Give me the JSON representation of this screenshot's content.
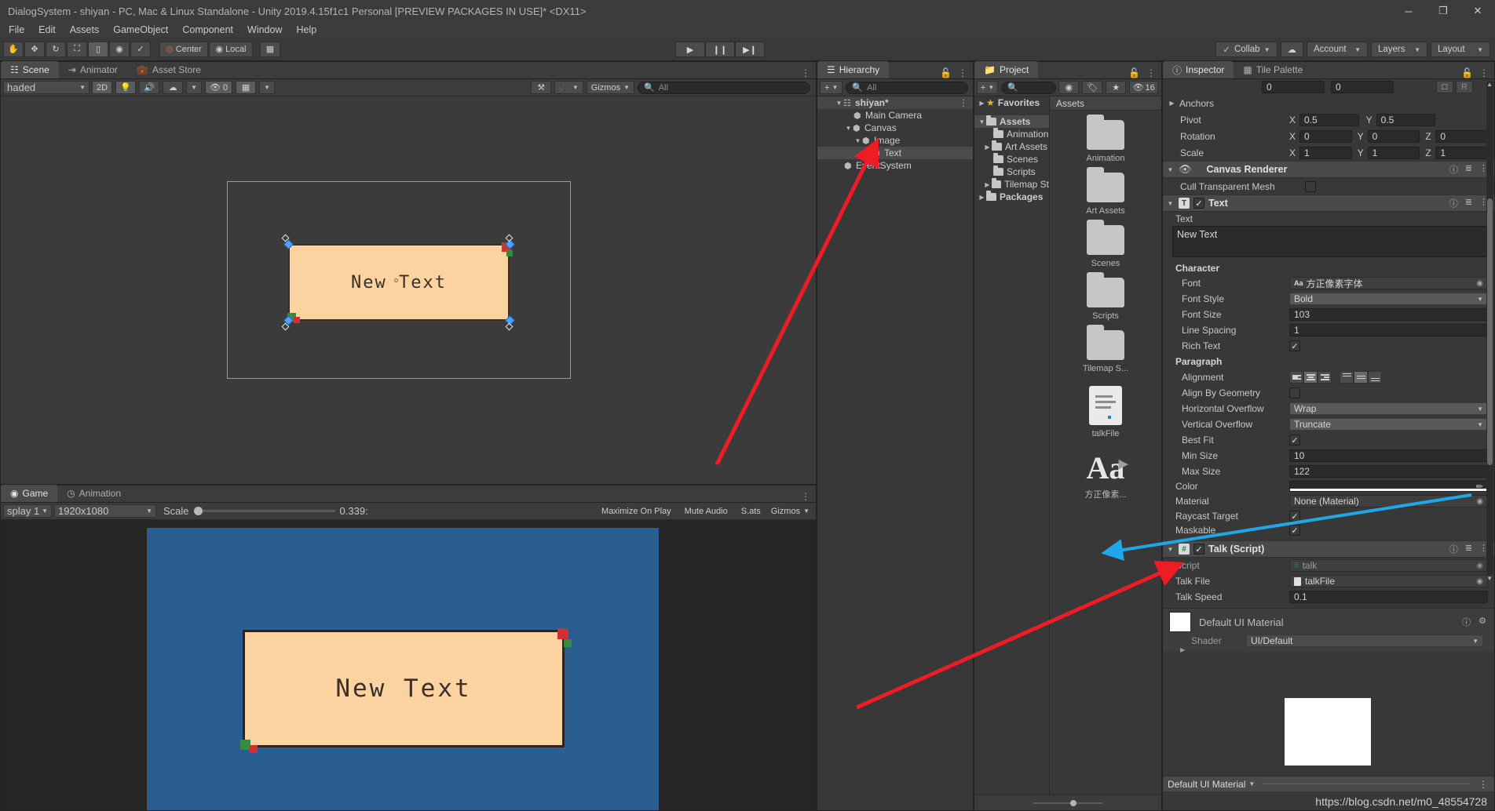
{
  "window": {
    "title": "DialogSystem - shiyan - PC, Mac & Linux Standalone - Unity 2019.4.15f1c1 Personal [PREVIEW PACKAGES IN USE]* <DX11>",
    "minimize": "─",
    "maximize": "❐",
    "close": "✕"
  },
  "menu": {
    "items": [
      "File",
      "Edit",
      "Assets",
      "GameObject",
      "Component",
      "Window",
      "Help"
    ]
  },
  "toolbar": {
    "tools": [
      "hand-tool",
      "move-tool",
      "rotate-tool",
      "scale-tool",
      "rect-tool",
      "transform-tool",
      "custom-tool"
    ],
    "pivot_mode": "Center",
    "pivot_rotation": "Local",
    "grid_label": "",
    "play": "▶",
    "pause": "❙❙",
    "step": "▶❙",
    "collab": "Collab",
    "cloud": "cloud-icon",
    "account": "Account",
    "layers": "Layers",
    "layout": "Layout"
  },
  "scene": {
    "tabs": [
      {
        "label": "Scene",
        "active": true
      },
      {
        "label": "Animator",
        "active": false
      },
      {
        "label": "Asset Store",
        "active": false
      }
    ],
    "draw_mode": "haded",
    "mode_2d": "2D",
    "gizmo_count": "0",
    "gizmos_label": "Gizmos",
    "search_placeholder": "All",
    "text_content": "New Text"
  },
  "game": {
    "tabs": [
      {
        "label": "Game",
        "active": true
      },
      {
        "label": "Animation",
        "active": false
      }
    ],
    "display": "splay 1",
    "resolution": "1920x1080",
    "scale_label": "Scale",
    "scale_value": "0.339:",
    "maximize_on_play": "Maximize On Play",
    "mute_audio": "Mute Audio",
    "stats": "S.ats",
    "gizmos": "Gizmos",
    "text_content": "New Text"
  },
  "hierarchy": {
    "tab": "Hierarchy",
    "create_label": "+",
    "search_placeholder": "All",
    "items": [
      {
        "label": "shiyan*",
        "depth": 0,
        "expanded": true,
        "selected": false,
        "is_scene": true
      },
      {
        "label": "Main Camera",
        "depth": 2,
        "expanded": null,
        "selected": false
      },
      {
        "label": "Canvas",
        "depth": 1,
        "expanded": true,
        "selected": false
      },
      {
        "label": "Image",
        "depth": 2,
        "expanded": true,
        "selected": false
      },
      {
        "label": "Text",
        "depth": 3,
        "expanded": null,
        "selected": true
      },
      {
        "label": "EventSystem",
        "depth": 1,
        "expanded": null,
        "selected": false
      }
    ]
  },
  "project": {
    "tab": "Project",
    "search_placeholder": "",
    "hidden_count": "16",
    "tree": [
      {
        "label": "Favorites",
        "depth": 0,
        "expanded": false,
        "favorite": true
      },
      {
        "label": "Assets",
        "depth": 0,
        "expanded": true,
        "selected": true
      },
      {
        "label": "Animation",
        "depth": 1,
        "expanded": null
      },
      {
        "label": "Art Assets",
        "depth": 1,
        "expanded": false
      },
      {
        "label": "Scenes",
        "depth": 1,
        "expanded": null
      },
      {
        "label": "Scripts",
        "depth": 1,
        "expanded": null
      },
      {
        "label": "Tilemap St",
        "depth": 1,
        "expanded": false
      },
      {
        "label": "Packages",
        "depth": 0,
        "expanded": false
      }
    ],
    "breadcrumb": "Assets",
    "assets": [
      {
        "label": "Animation",
        "type": "folder"
      },
      {
        "label": "Art Assets",
        "type": "folder"
      },
      {
        "label": "Scenes",
        "type": "folder"
      },
      {
        "label": "Scripts",
        "type": "folder"
      },
      {
        "label": "Tilemap S...",
        "type": "folder"
      },
      {
        "label": "talkFile",
        "type": "textfile"
      },
      {
        "label": "方正像素...",
        "type": "font"
      }
    ]
  },
  "inspector": {
    "tabs": [
      {
        "label": "Inspector",
        "active": true
      },
      {
        "label": "Tile Palette",
        "active": false
      }
    ],
    "rect_top_fields": [
      "0",
      "0"
    ],
    "rect_buttons": [
      "blueprint-icon",
      "R"
    ],
    "anchors_label": "Anchors",
    "pivot": {
      "label": "Pivot",
      "x": "0.5",
      "y": "0.5"
    },
    "rotation": {
      "label": "Rotation",
      "x": "0",
      "y": "0",
      "z": "0"
    },
    "scale": {
      "label": "Scale",
      "x": "1",
      "y": "1",
      "z": "1"
    },
    "canvas_renderer": {
      "title": "Canvas Renderer",
      "cull_transparent_mesh": {
        "label": "Cull Transparent Mesh",
        "checked": false
      }
    },
    "text_component": {
      "title": "Text",
      "enabled": true,
      "text_label": "Text",
      "text_value": "New Text",
      "character_label": "Character",
      "font": {
        "label": "Font",
        "value": "方正像素字体"
      },
      "font_style": {
        "label": "Font Style",
        "value": "Bold"
      },
      "font_size": {
        "label": "Font Size",
        "value": "103"
      },
      "line_spacing": {
        "label": "Line Spacing",
        "value": "1"
      },
      "rich_text": {
        "label": "Rich Text",
        "checked": true
      },
      "paragraph_label": "Paragraph",
      "alignment": {
        "label": "Alignment",
        "horizontal_selected": 1,
        "vertical_selected": 1
      },
      "align_by_geometry": {
        "label": "Align By Geometry",
        "checked": false
      },
      "horizontal_overflow": {
        "label": "Horizontal Overflow",
        "value": "Wrap"
      },
      "vertical_overflow": {
        "label": "Vertical Overflow",
        "value": "Truncate"
      },
      "best_fit": {
        "label": "Best Fit",
        "checked": true
      },
      "min_size": {
        "label": "Min Size",
        "value": "10"
      },
      "max_size": {
        "label": "Max Size",
        "value": "122"
      },
      "color": {
        "label": "Color",
        "value": "#ffffff"
      },
      "material": {
        "label": "Material",
        "value": "None (Material)"
      },
      "raycast_target": {
        "label": "Raycast Target",
        "checked": true
      },
      "maskable": {
        "label": "Maskable",
        "checked": true
      }
    },
    "talk_script": {
      "title": "Talk (Script)",
      "enabled": true,
      "script": {
        "label": "Script",
        "value": "talk"
      },
      "talk_file": {
        "label": "Talk File",
        "value": "talkFile"
      },
      "talk_speed": {
        "label": "Talk Speed",
        "value": "0.1"
      }
    },
    "material_preview": {
      "name": "Default UI Material",
      "shader_label": "Shader",
      "shader_value": "UI/Default",
      "footer_name": "Default UI Material"
    }
  },
  "watermark": "https://blog.csdn.net/m0_48554728",
  "colors": {
    "accent_blue": "#2a5d90",
    "panel_bg": "#383838",
    "dialog_fill": "#fbd3a0",
    "arrow_red": "#ee1c25",
    "arrow_blue": "#1fa7e8"
  }
}
